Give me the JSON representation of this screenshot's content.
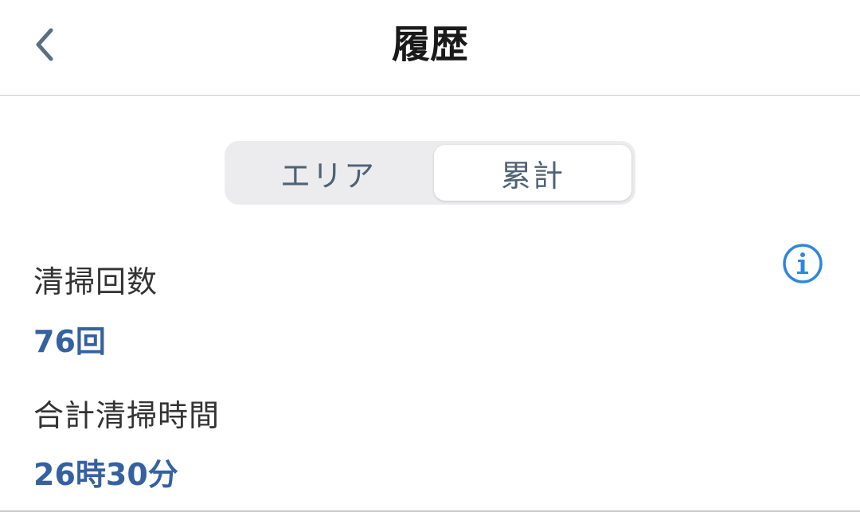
{
  "header": {
    "title": "履歴"
  },
  "tabs": [
    {
      "label": "エリア",
      "selected": false
    },
    {
      "label": "累計",
      "selected": true
    }
  ],
  "stats": {
    "cleaning_count": {
      "label": "清掃回数",
      "value": "76回"
    },
    "total_cleaning_time": {
      "label": "合計清掃時間",
      "value": "26時30分"
    }
  },
  "icons": {
    "back": "chevron-left-icon",
    "info": "info-icon"
  },
  "colors": {
    "accent": "#3561a1",
    "info_blue": "#2f86e0",
    "segment_text": "#4f6275",
    "segment_bg": "#ececee"
  }
}
